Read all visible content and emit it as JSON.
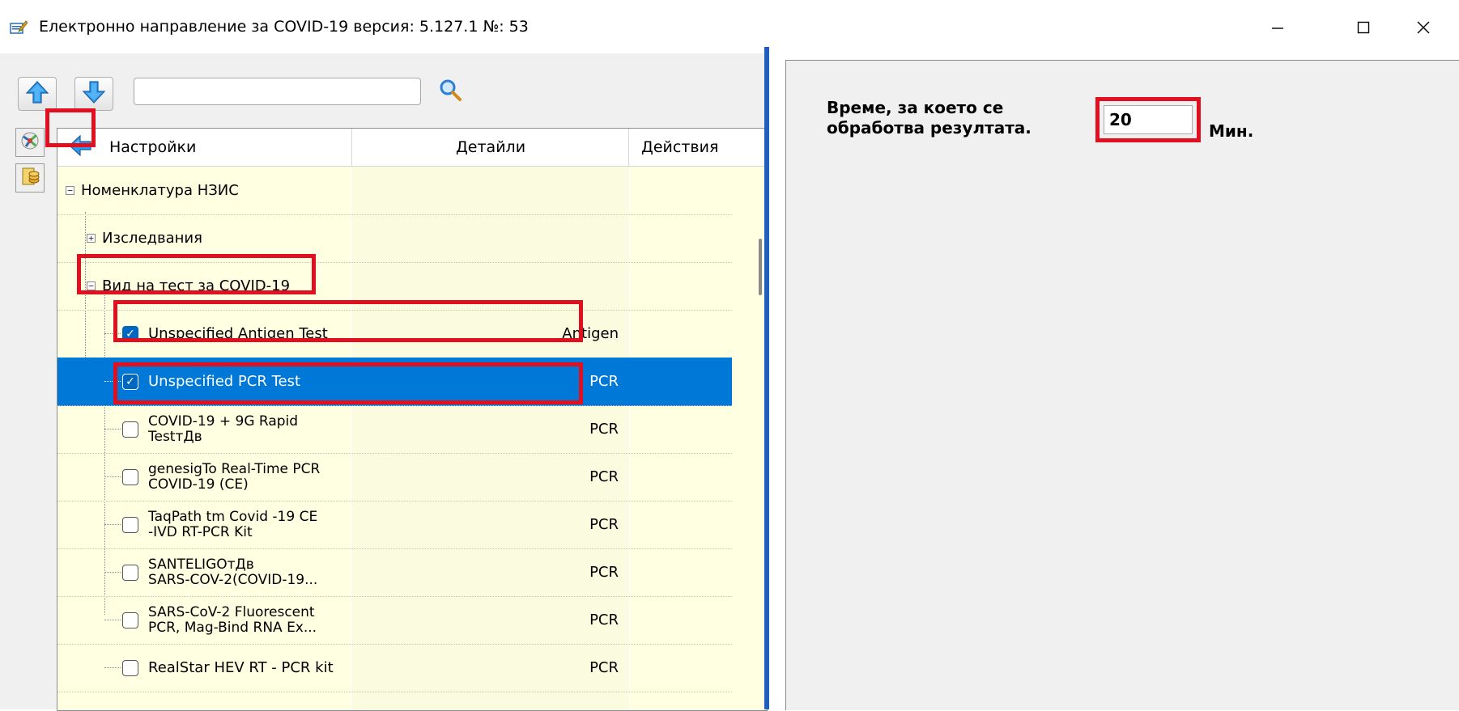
{
  "window": {
    "title": "Електронно направление за COVID-19 версия: 5.127.1 №: 53",
    "app_icon": "document-edit-icon",
    "controls": {
      "minimize": "—",
      "maximize": "☐",
      "close": "✕"
    }
  },
  "toolbar": {
    "up_icon": "arrow-up-icon",
    "down_icon": "arrow-down-icon",
    "search_value": "",
    "search_icon": "search-icon"
  },
  "sidebar": {
    "buttons": [
      "tools-icon",
      "coins-icon"
    ]
  },
  "grid": {
    "back_icon": "arrow-left-icon",
    "columns": {
      "settings": "Настройки",
      "details": "Детайли",
      "actions": "Действия"
    },
    "rows": [
      {
        "label": "Номенклатура НЗИС",
        "detail": "",
        "expander": "−"
      },
      {
        "label": "Изследвания",
        "detail": "",
        "expander": "+"
      },
      {
        "label": "Вид на тест за COVID-19",
        "detail": "",
        "expander": "−"
      },
      {
        "label": "Unspecified Antigen Test",
        "detail": "Antigen",
        "checked": true
      },
      {
        "label": "Unspecified PCR Test",
        "detail": "PCR",
        "checked": true,
        "selected": true
      },
      {
        "label": "COVID-19 + 9G Rapid TestтДв",
        "detail": "PCR",
        "checked": false
      },
      {
        "label": "genesigTo Real-Time PCR COVID-19 (CE)",
        "detail": "PCR",
        "checked": false
      },
      {
        "label": "TaqPath tm Covid -19 CE -IVD RT-PCR Kit",
        "detail": "PCR",
        "checked": false
      },
      {
        "label": "SANTELIGOтДв SARS-COV-2(COVID-19...",
        "detail": "PCR",
        "checked": false
      },
      {
        "label": "SARS-CoV-2 Fluorescent PCR, Mag-Bind RNA Ex...",
        "detail": "PCR",
        "checked": false
      },
      {
        "label": "RealStar HEV RT - PCR kit",
        "detail": "PCR",
        "checked": false
      }
    ],
    "row_labels_split": {
      "r5a": "COVID-19 + 9G Rapid",
      "r5b": "TestтДв",
      "r6a": "genesigTo Real-Time PCR",
      "r6b": "COVID-19 (CE)",
      "r7a": "TaqPath tm Covid -19 CE",
      "r7b": "-IVD RT-PCR Kit",
      "r8a": "SANTELIGOтДв",
      "r8b": "SARS-COV-2(COVID-19...",
      "r9a": "SARS-CoV-2 Fluorescent",
      "r9b": "PCR, Mag-Bind RNA Ex..."
    }
  },
  "detail_panel": {
    "time_label_line1": "Време, за което се",
    "time_label_line2": "обработва резултата.",
    "time_value": "20",
    "time_unit": "Мин."
  },
  "colors": {
    "selection": "#0078d7",
    "highlight": "#e01020",
    "tree_bg": "#ffffe1",
    "splitter": "#1f5fbf"
  }
}
